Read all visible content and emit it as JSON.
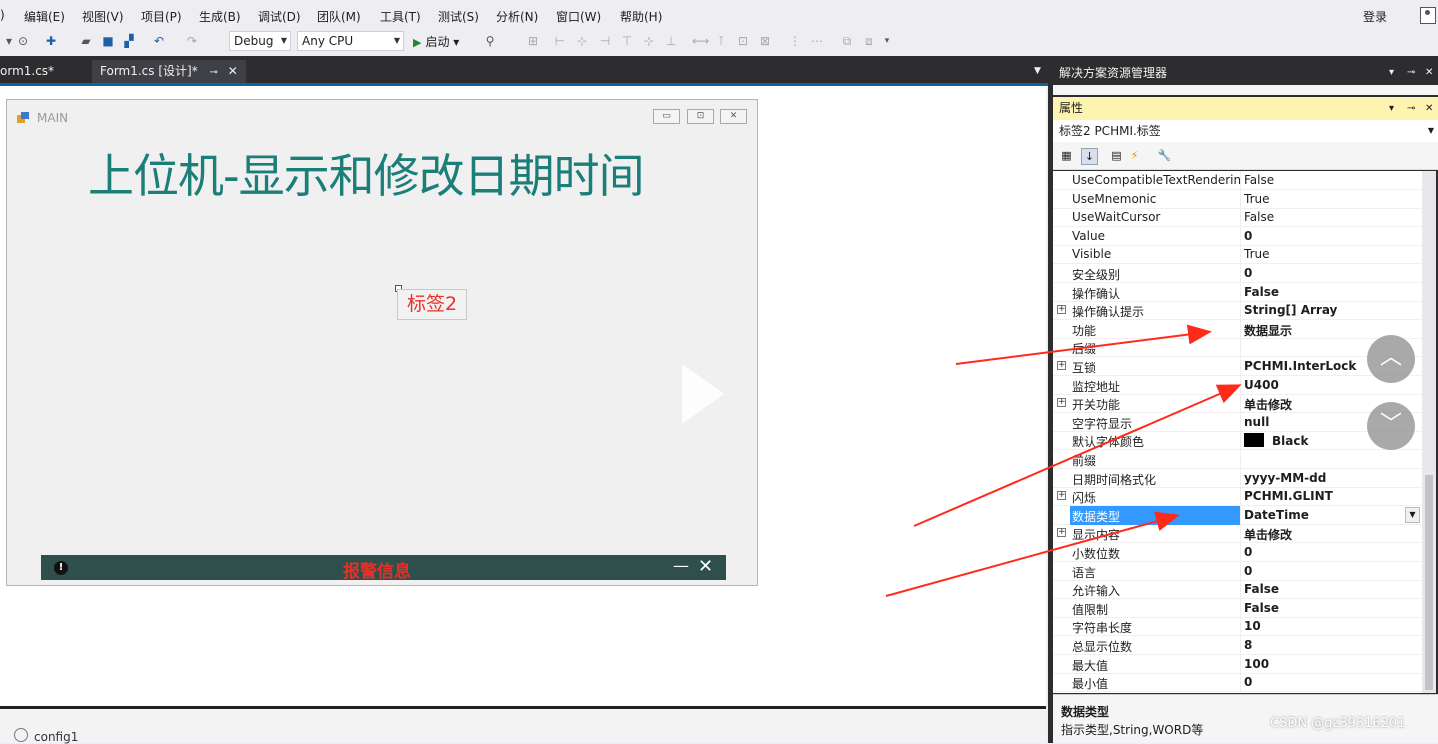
{
  "menu": {
    "items": [
      "编辑(E)",
      "视图(V)",
      "项目(P)",
      "生成(B)",
      "调试(D)",
      "团队(M)",
      "工具(T)",
      "测试(S)",
      "分析(N)",
      "窗口(W)",
      "帮助(H)"
    ],
    "partial_first": ")",
    "login": "登录"
  },
  "toolbar": {
    "config": "Debug",
    "platform": "Any CPU",
    "start": "启动"
  },
  "tabs": {
    "tab1": "orm1.cs*",
    "tab2": "Form1.cs [设计]*"
  },
  "form": {
    "title": "MAIN",
    "heading": "上位机-显示和修改日期时间",
    "label2": "标签2",
    "alarm": "报警信息"
  },
  "tray": {
    "component": "config1"
  },
  "solution_explorer": {
    "title": "解决方案资源管理器"
  },
  "properties": {
    "title": "属性",
    "object": "标签2  PCHMI.标签",
    "rows": [
      {
        "name": "UseCompatibleTextRendering",
        "value": "False",
        "bold": false,
        "expand": false
      },
      {
        "name": "UseMnemonic",
        "value": "True",
        "bold": false,
        "expand": false
      },
      {
        "name": "UseWaitCursor",
        "value": "False",
        "bold": false,
        "expand": false
      },
      {
        "name": "Value",
        "value": "0",
        "bold": true,
        "expand": false
      },
      {
        "name": "Visible",
        "value": "True",
        "bold": false,
        "expand": false
      },
      {
        "name": "安全级别",
        "value": "0",
        "bold": true,
        "expand": false
      },
      {
        "name": "操作确认",
        "value": "False",
        "bold": true,
        "expand": false
      },
      {
        "name": "操作确认提示",
        "value": "String[] Array",
        "bold": true,
        "expand": true
      },
      {
        "name": "功能",
        "value": "数据显示",
        "bold": true,
        "expand": false
      },
      {
        "name": "后缀",
        "value": "",
        "bold": false,
        "expand": false
      },
      {
        "name": "互锁",
        "value": "PCHMI.InterLock",
        "bold": true,
        "expand": true
      },
      {
        "name": "监控地址",
        "value": "U400",
        "bold": true,
        "expand": false
      },
      {
        "name": "开关功能",
        "value": "单击修改",
        "bold": true,
        "expand": true
      },
      {
        "name": "空字符显示",
        "value": "null",
        "bold": true,
        "expand": false
      },
      {
        "name": "默认字体颜色",
        "value": "Black",
        "bold": true,
        "expand": false
      },
      {
        "name": "前缀",
        "value": "",
        "bold": false,
        "expand": false
      },
      {
        "name": "日期时间格式化",
        "value": "yyyy-MM-dd",
        "bold": true,
        "expand": false
      },
      {
        "name": "闪烁",
        "value": "PCHMI.GLINT",
        "bold": true,
        "expand": true
      },
      {
        "name": "数据类型",
        "value": "DateTime",
        "bold": true,
        "expand": false
      },
      {
        "name": "显示内容",
        "value": "单击修改",
        "bold": true,
        "expand": true
      },
      {
        "name": "小数位数",
        "value": "0",
        "bold": true,
        "expand": false
      },
      {
        "name": "语言",
        "value": "0",
        "bold": true,
        "expand": false
      },
      {
        "name": "允许输入",
        "value": "False",
        "bold": true,
        "expand": false
      },
      {
        "name": "值限制",
        "value": "False",
        "bold": true,
        "expand": false
      },
      {
        "name": "字符串长度",
        "value": "10",
        "bold": true,
        "expand": false
      },
      {
        "name": "总显示位数",
        "value": "8",
        "bold": true,
        "expand": false
      },
      {
        "name": "最大值",
        "value": "100",
        "bold": true,
        "expand": false
      },
      {
        "name": "最小值",
        "value": "0",
        "bold": true,
        "expand": false
      }
    ],
    "desc_title": "数据类型",
    "desc_text": "指示类型,String,WORD等"
  },
  "watermark": "CSDN @gz39316201",
  "colors": {
    "heading": "#1c7e78",
    "label_text": "#e8312b",
    "selection": "#3399ff",
    "arrow": "#ff2a1a",
    "alarm_bar": "#2f4f4c"
  }
}
